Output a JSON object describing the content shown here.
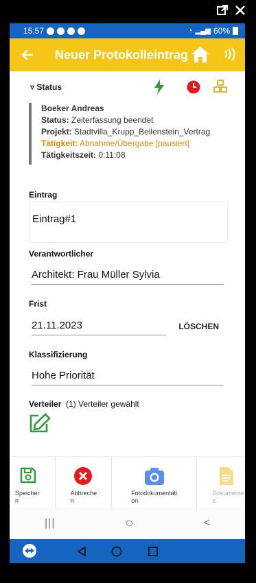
{
  "statusbar": {
    "time": "15:57",
    "battery": "60%"
  },
  "appbar": {
    "title": "Neuer Protokolleintrag"
  },
  "status": {
    "label": "Status",
    "person": "Boeker Andreas",
    "status_label": "Status:",
    "status_value": "Zeiterfassung beendet",
    "project_label": "Projekt:",
    "project_value": "Stadtvilla_Krupp_Beilenstein_Vertrag",
    "activity_label": "Tätigkeit:",
    "activity_value": "Abnahme/Übergabe [pausiert]",
    "time_label": "Tätigkeitszeit:",
    "time_value": "0:11:08",
    "colors": {
      "bolt": "#2e9a3a",
      "clock": "#e41b1b",
      "cubes": "#e0b020",
      "activity": "#e08a00"
    }
  },
  "form": {
    "entry_label": "Eintrag",
    "entry_value": "Eintrag#1",
    "responsible_label": "Verantwortlicher",
    "responsible_value": "Architekt: Frau Müller Sylvia",
    "deadline_label": "Frist",
    "deadline_value": "21.11.2023",
    "clear_label": "LÖSCHEN",
    "classification_label": "Klassifizierung",
    "classification_value": "Hohe Priorität",
    "distribution_label": "Verteiler",
    "distribution_value": "(1) Verteiler gewählt"
  },
  "toolbar": {
    "save_line1": "Speicher",
    "save_line2": "n",
    "cancel_line1": "Abbreche",
    "cancel_line2": "n",
    "photo_line1": "Fotodokumentati",
    "photo_line2": "on",
    "docs_line1": "Dokumente",
    "docs_line2": "e"
  },
  "android_nav": {
    "recents": "|||",
    "home": "○",
    "back": "<"
  }
}
